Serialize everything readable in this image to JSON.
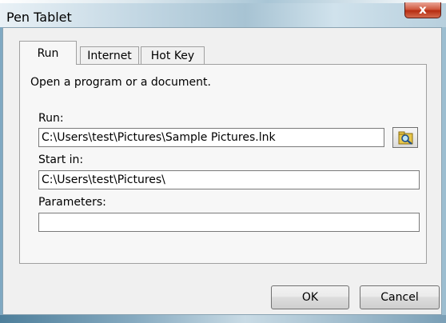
{
  "window": {
    "title": "Pen Tablet",
    "close_label": "x"
  },
  "tabs": [
    {
      "label": "Run",
      "active": true
    },
    {
      "label": "Internet",
      "active": false
    },
    {
      "label": "Hot Key",
      "active": false
    }
  ],
  "panel": {
    "description": "Open a program or a document.",
    "run_label": "Run:",
    "run_value": "C:\\Users\\test\\Pictures\\Sample Pictures.lnk",
    "start_in_label": "Start in:",
    "start_in_value": "C:\\Users\\test\\Pictures\\",
    "parameters_label": "Parameters:",
    "parameters_value": "",
    "browse_icon": "magnifier-folder-icon"
  },
  "buttons": {
    "ok_label": "OK",
    "cancel_label": "Cancel"
  },
  "colors": {
    "close_button": "#c8452a",
    "dialog_face": "#f0f0f0"
  }
}
